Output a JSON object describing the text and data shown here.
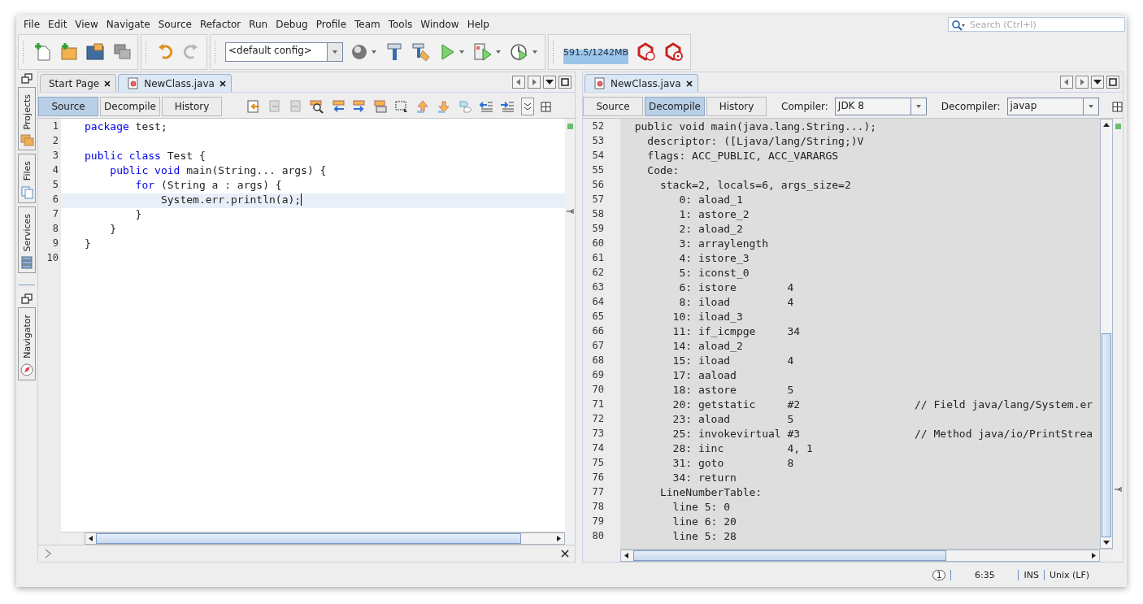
{
  "menu": [
    "File",
    "Edit",
    "View",
    "Navigate",
    "Source",
    "Refactor",
    "Run",
    "Debug",
    "Profile",
    "Team",
    "Tools",
    "Window",
    "Help"
  ],
  "search": {
    "placeholder": "Search (Ctrl+I)"
  },
  "toolbar": {
    "config": "<default config>",
    "memory": "591.5/1242MB"
  },
  "side_tabs": [
    {
      "label": "Projects",
      "kind": "projects"
    },
    {
      "label": "Files",
      "kind": "files"
    },
    {
      "label": "Services",
      "kind": "services"
    },
    {
      "label": "Navigator",
      "kind": "navigator"
    }
  ],
  "left_editor": {
    "tabs": [
      {
        "label": "Start Page",
        "selected": false
      },
      {
        "label": "NewClass.java",
        "selected": true
      }
    ],
    "views": [
      {
        "label": "Source",
        "selected": true
      },
      {
        "label": "Decompile",
        "selected": false
      },
      {
        "label": "History",
        "selected": false
      }
    ],
    "lines": [
      {
        "number": "1",
        "current": false,
        "tokens": [
          {
            "text": "package",
            "kind": "keyword"
          },
          {
            "text": " test;",
            "kind": "plain"
          }
        ]
      },
      {
        "number": "2",
        "current": false
      },
      {
        "number": "3",
        "current": false,
        "tokens": [
          {
            "text": "public class",
            "kind": "keyword"
          },
          {
            "text": " Test {",
            "kind": "plain"
          }
        ]
      },
      {
        "number": "4",
        "current": false,
        "tokens": [
          {
            "text": "    public void",
            "kind": "keyword"
          },
          {
            "text": " main(String... args) {",
            "kind": "plain"
          }
        ]
      },
      {
        "number": "5",
        "current": false,
        "tokens": [
          {
            "text": "        for",
            "kind": "keyword"
          },
          {
            "text": " (String a : args) {",
            "kind": "plain"
          }
        ]
      },
      {
        "number": "6",
        "current": true,
        "tokens": [
          {
            "text": "            System.err.println(a);",
            "kind": "plain"
          }
        ]
      },
      {
        "number": "7",
        "current": false,
        "tokens": [
          {
            "text": "        }",
            "kind": "plain"
          }
        ]
      },
      {
        "number": "8",
        "current": false,
        "tokens": [
          {
            "text": "    }",
            "kind": "plain"
          }
        ]
      },
      {
        "number": "9",
        "current": false,
        "tokens": [
          {
            "text": "}",
            "kind": "plain"
          }
        ]
      },
      {
        "number": "10",
        "current": false
      }
    ]
  },
  "right_editor": {
    "tabs": [
      {
        "label": "NewClass.java",
        "selected": true
      }
    ],
    "views": [
      {
        "label": "Source",
        "selected": false
      },
      {
        "label": "Decompile",
        "selected": true
      },
      {
        "label": "History",
        "selected": false
      }
    ],
    "compiler": {
      "label": "Compiler:",
      "value": "JDK 8"
    },
    "decompiler": {
      "label": "Decompiler:",
      "value": "javap"
    },
    "lines": [
      {
        "number": "52",
        "text": "  public void main(java.lang.String...);"
      },
      {
        "number": "53",
        "text": "    descriptor: ([Ljava/lang/String;)V"
      },
      {
        "number": "54",
        "text": "    flags: ACC_PUBLIC, ACC_VARARGS"
      },
      {
        "number": "55",
        "text": "    Code:"
      },
      {
        "number": "56",
        "text": "      stack=2, locals=6, args_size=2"
      },
      {
        "number": "57",
        "text": "         0: aload_1"
      },
      {
        "number": "58",
        "text": "         1: astore_2"
      },
      {
        "number": "59",
        "text": "         2: aload_2"
      },
      {
        "number": "60",
        "text": "         3: arraylength"
      },
      {
        "number": "61",
        "text": "         4: istore_3"
      },
      {
        "number": "62",
        "text": "         5: iconst_0"
      },
      {
        "number": "63",
        "text": "         6: istore        4"
      },
      {
        "number": "64",
        "text": "         8: iload         4"
      },
      {
        "number": "65",
        "text": "        10: iload_3"
      },
      {
        "number": "66",
        "text": "        11: if_icmpge     34"
      },
      {
        "number": "67",
        "text": "        14: aload_2"
      },
      {
        "number": "68",
        "text": "        15: iload         4"
      },
      {
        "number": "69",
        "text": "        17: aaload"
      },
      {
        "number": "70",
        "text": "        18: astore        5"
      },
      {
        "number": "71",
        "text": "        20: getstatic     #2                  // Field java/lang/System.er"
      },
      {
        "number": "72",
        "text": "        23: aload         5"
      },
      {
        "number": "73",
        "text": "        25: invokevirtual #3                  // Method java/io/PrintStrea"
      },
      {
        "number": "74",
        "text": "        28: iinc          4, 1"
      },
      {
        "number": "75",
        "text": "        31: goto          8"
      },
      {
        "number": "76",
        "text": "        34: return"
      },
      {
        "number": "77",
        "text": "      LineNumberTable:"
      },
      {
        "number": "78",
        "text": "        line 5: 0"
      },
      {
        "number": "79",
        "text": "        line 6: 20"
      },
      {
        "number": "80",
        "text": "        line 5: 28"
      }
    ]
  },
  "status_bar": {
    "notifications": "1",
    "position": "6:35",
    "mode": "INS",
    "line_endings": "Unix (LF)"
  }
}
